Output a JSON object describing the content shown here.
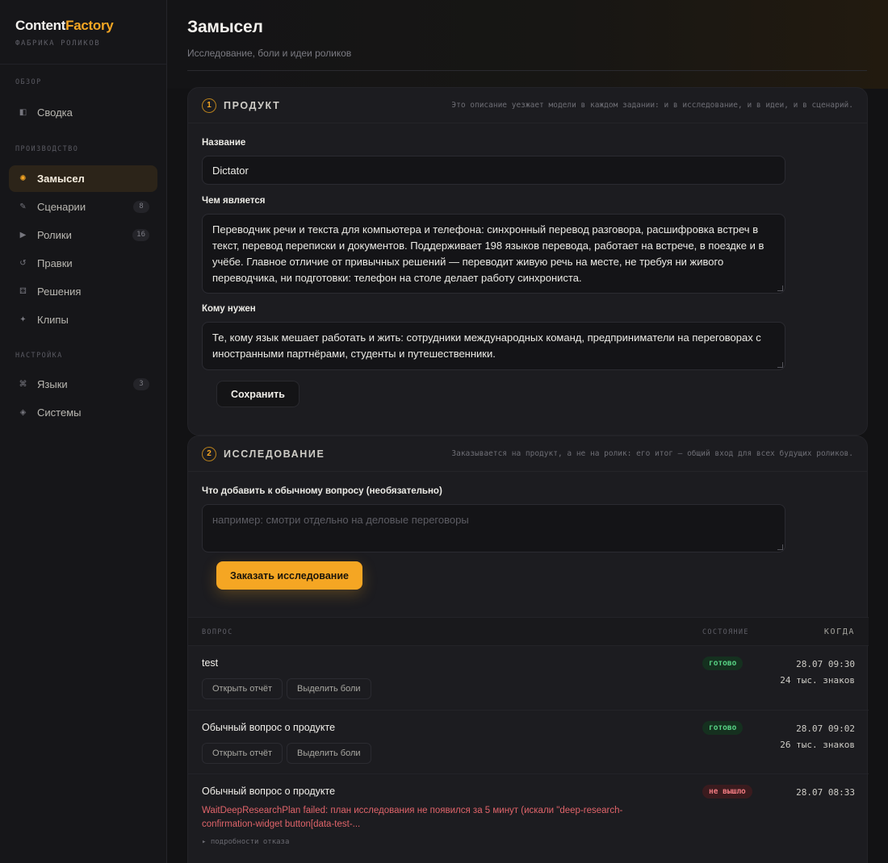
{
  "brand": {
    "name_main": "Content",
    "name_accent": "Factory",
    "subtitle": "Фабрика роликов"
  },
  "sidebar": {
    "sections": [
      {
        "title": "Обзор",
        "items": [
          {
            "label": "Сводка",
            "icon": "dashboard-icon",
            "glyph": "◧",
            "count": ""
          }
        ]
      },
      {
        "title": "Производство",
        "items": [
          {
            "label": "Замысел",
            "icon": "idea-icon",
            "glyph": "✺",
            "count": "",
            "active": true
          },
          {
            "label": "Сценарии",
            "icon": "pen-icon",
            "glyph": "✎",
            "count": "8"
          },
          {
            "label": "Ролики",
            "icon": "play-icon",
            "glyph": "▶",
            "count": "16"
          },
          {
            "label": "Правки",
            "icon": "refresh-icon",
            "glyph": "↺",
            "count": ""
          },
          {
            "label": "Решения",
            "icon": "grid-icon",
            "glyph": "⚃",
            "count": ""
          },
          {
            "label": "Клипы",
            "icon": "sparkle-icon",
            "glyph": "✦",
            "count": ""
          }
        ]
      },
      {
        "title": "Настройка",
        "items": [
          {
            "label": "Языки",
            "icon": "command-icon",
            "glyph": "⌘",
            "count": "3"
          },
          {
            "label": "Системы",
            "icon": "diamond-icon",
            "glyph": "◈",
            "count": ""
          }
        ]
      }
    ]
  },
  "header": {
    "title": "Замысел",
    "subtitle": "Исследование, боли и идеи роликов"
  },
  "product": {
    "step": "1",
    "title": "Продукт",
    "note": "Это описание уезжает модели в каждом задании: и в исследование, и в идеи, и в сценарий.",
    "name_label": "Название",
    "name_value": "Dictator",
    "what_label": "Чем является",
    "what_value": "Переводчик речи и текста для компьютера и телефона: синхронный перевод разговора, расшифровка встреч в текст, перевод переписки и документов. Поддерживает 198 языков перевода, работает на встрече, в поездке и в учёбе. Главное отличие от привычных решений — переводит живую речь на месте, не требуя ни живого переводчика, ни подготовки: телефон на столе делает работу синхрониста.",
    "who_label": "Кому нужен",
    "who_value": "Те, кому язык мешает работать и жить: сотрудники международных команд, предприниматели на переговорах с иностранными партнёрами, студенты и путешественники.",
    "save_label": "Сохранить"
  },
  "research": {
    "step": "2",
    "title": "Исследование",
    "note": "Заказывается на продукт, а не на ролик: его итог — общий вход для всех будущих роликов.",
    "extra_label": "Что добавить к обычному вопросу (необязательно)",
    "extra_placeholder": "например: смотри отдельно на деловые переговоры",
    "order_label": "Заказать исследование",
    "columns": {
      "question": "Вопрос",
      "status": "Состояние",
      "when": "Когда"
    },
    "rows": [
      {
        "question": "test",
        "status": "готово",
        "status_type": "ok",
        "date": "28.07 09:30",
        "size": "24 тыс. знаков",
        "open_label": "Открыть отчёт",
        "pains_label": "Выделить боли"
      },
      {
        "question": "Обычный вопрос о продукте",
        "status": "готово",
        "status_type": "ok",
        "date": "28.07 09:02",
        "size": "26 тыс. знаков",
        "open_label": "Открыть отчёт",
        "pains_label": "Выделить боли"
      },
      {
        "question": "Обычный вопрос о продукте",
        "status": "не вышло",
        "status_type": "fail",
        "date": "28.07 08:33",
        "error": "WaitDeepResearchPlan failed: план исследования не появился за 5 минут (искали \"deep-research-confirmation-widget button[data-test-...",
        "details_label": "▸ подробности отказа"
      }
    ]
  },
  "colors": {
    "accent": "#f5a623",
    "ok": "#57d284",
    "fail": "#f07a80",
    "bg": "#121214",
    "card": "#1c1c20"
  }
}
